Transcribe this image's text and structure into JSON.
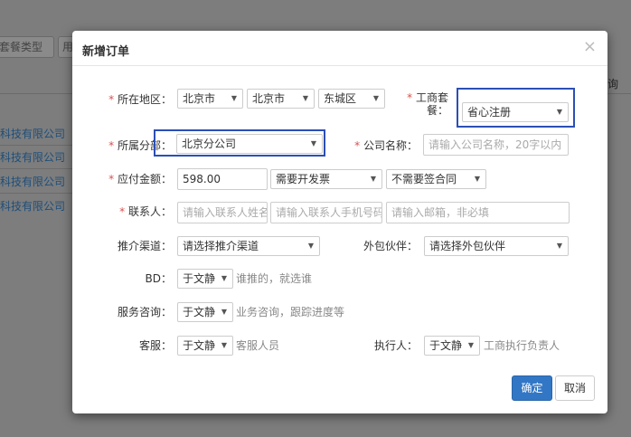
{
  "background": {
    "filter_label": "套餐类型",
    "filter2_label": "用",
    "right_header": "询",
    "rows": [
      "科技有限公司",
      "科技有限公司",
      "科技有限公司",
      "科技有限公司"
    ]
  },
  "modal": {
    "title": "新增订单",
    "close": "×",
    "fields": {
      "region": {
        "label": "所在地区：",
        "province": "北京市",
        "city": "北京市",
        "district": "东城区"
      },
      "package": {
        "label_line1": "工商套",
        "label_line2": "餐：",
        "value": "省心注册"
      },
      "branch": {
        "label": "所属分部：",
        "value": "北京分公司"
      },
      "company": {
        "label": "公司名称：",
        "placeholder": "请输入公司名称，20字以内"
      },
      "amount": {
        "label": "应付金额：",
        "value": "598.00",
        "invoice": "需要开发票",
        "contract": "不需要签合同"
      },
      "contact": {
        "label": "联系人：",
        "name_placeholder": "请输入联系人姓名",
        "phone_placeholder": "请输入联系人手机号码",
        "email_placeholder": "请输入邮箱，非必填"
      },
      "channel": {
        "label": "推介渠道：",
        "value": "请选择推介渠道"
      },
      "partner": {
        "label": "外包伙伴：",
        "value": "请选择外包伙伴"
      },
      "bd": {
        "label": "BD：",
        "value": "于文静",
        "hint": "谁推的，就选谁"
      },
      "consult": {
        "label": "服务咨询：",
        "value": "于文静",
        "hint": "业务咨询，跟踪进度等"
      },
      "service": {
        "label": "客服：",
        "value": "于文静",
        "hint": "客服人员"
      },
      "executor": {
        "label": "执行人：",
        "value": "于文静",
        "hint": "工商执行负责人"
      }
    },
    "required_mark": "*",
    "buttons": {
      "confirm": "确定",
      "cancel": "取消"
    }
  },
  "colors": {
    "primary": "#3277c5",
    "required": "#d9534f",
    "highlight": "#2b4fb5"
  }
}
